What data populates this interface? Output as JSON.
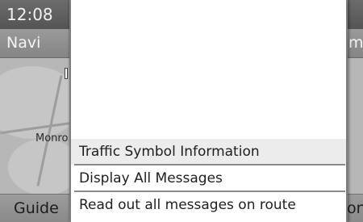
{
  "status": {
    "clock": "12:08"
  },
  "header": {
    "title": "Navi",
    "right_fragment": "m"
  },
  "map": {
    "place_label": "Monro"
  },
  "footer": {
    "guide_label": "Guide",
    "right_fragment": "on"
  },
  "menu": {
    "items": [
      {
        "label": "Traffic Symbol Information",
        "selected": true
      },
      {
        "label": "Display All Messages",
        "selected": false
      },
      {
        "label": "Read out all messages on route",
        "selected": false
      }
    ]
  }
}
